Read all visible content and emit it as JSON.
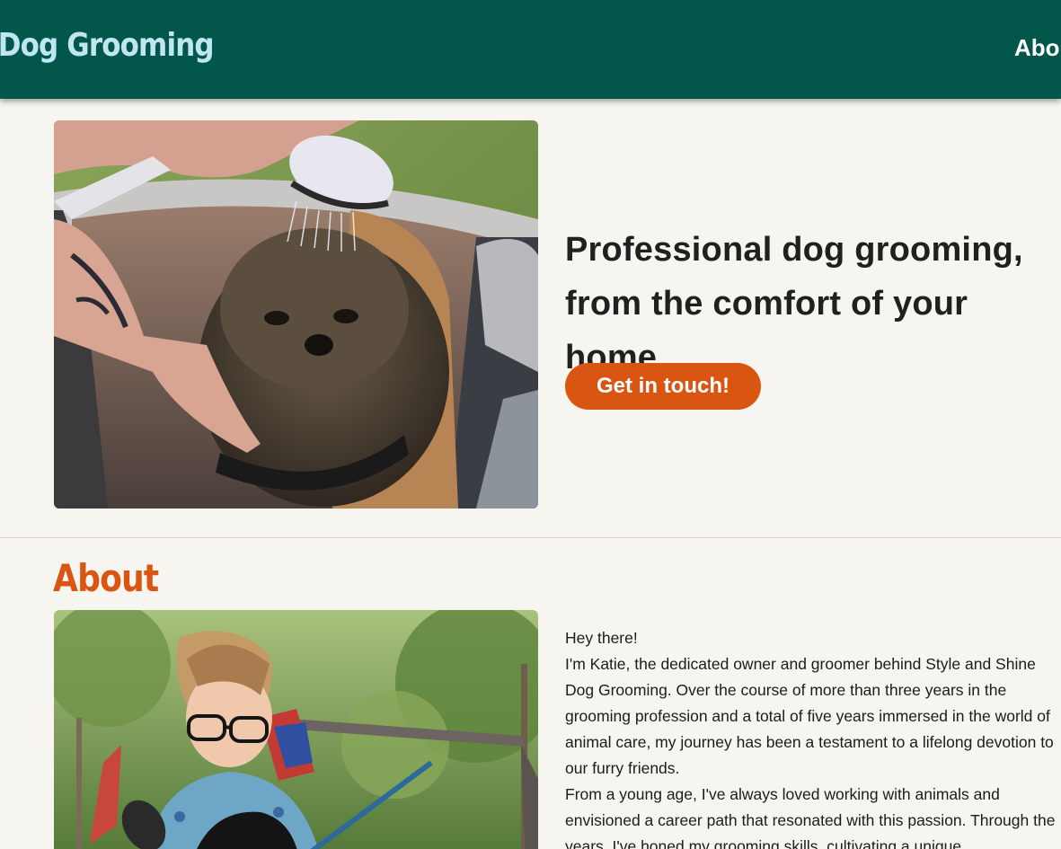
{
  "header": {
    "brand": "le Dog Grooming",
    "nav_about": "Abou"
  },
  "hero": {
    "headline": "Professional dog grooming, from the comfort of your home",
    "cta_label": "Get in touch!"
  },
  "about": {
    "heading": "About",
    "greeting": "Hey there!",
    "paragraph1": "I'm Katie, the dedicated owner and groomer behind Style and Shine Dog Grooming. Over the course of more than three years in the grooming profession and a total of five years immersed in the world of animal care, my journey has been a testament to a lifelong devotion to our furry friends.",
    "paragraph2": "From a young age, I've always loved working with animals and envisioned a career path that resonated with this passion. Through the years, I've honed my grooming skills, cultivating a unique"
  },
  "colors": {
    "header_bg": "#03574a",
    "brand_text": "#bfe6f2",
    "accent": "#d95612",
    "page_bg": "#f7f5f0"
  }
}
